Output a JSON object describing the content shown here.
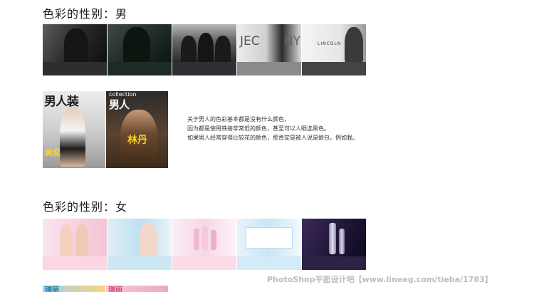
{
  "sections": {
    "male_heading": "色彩的性别：男",
    "female_heading": "色彩的性别：女"
  },
  "male_swatches": [
    "#2e2e2e",
    "#1e2b24",
    "#2e3035",
    "#8a8a8a",
    "#444444"
  ],
  "female_swatches": [
    "#fbd7e6",
    "#cde6f3",
    "#fbdbe8",
    "#d4ebf7",
    "#2d2244"
  ],
  "thumb_labels": {
    "m4": "JEC",
    "m4b": "NY",
    "m5": "LINCOLN"
  },
  "magazines": {
    "mag1_title": "男人装",
    "mag1_name": "黄奕",
    "mag2_sub": "collection",
    "mag2_title": "男人",
    "mag2_name": "林丹"
  },
  "caption": {
    "line1": "关于男人的色彩基本都是没有什么颜色，",
    "line2": "因为都是使用铁接非常低的颜色，甚至可以人眼选黑色。",
    "line3": "如果男人经常穿得比较花的颜色，那肯定是被人说是娘包，例如我。"
  },
  "partial_labels": {
    "p1": "瑞丽",
    "p2": "瑞丽"
  },
  "watermark": "PhotoShop平面设计吧【www.lineeg.com/tieba/1783】"
}
